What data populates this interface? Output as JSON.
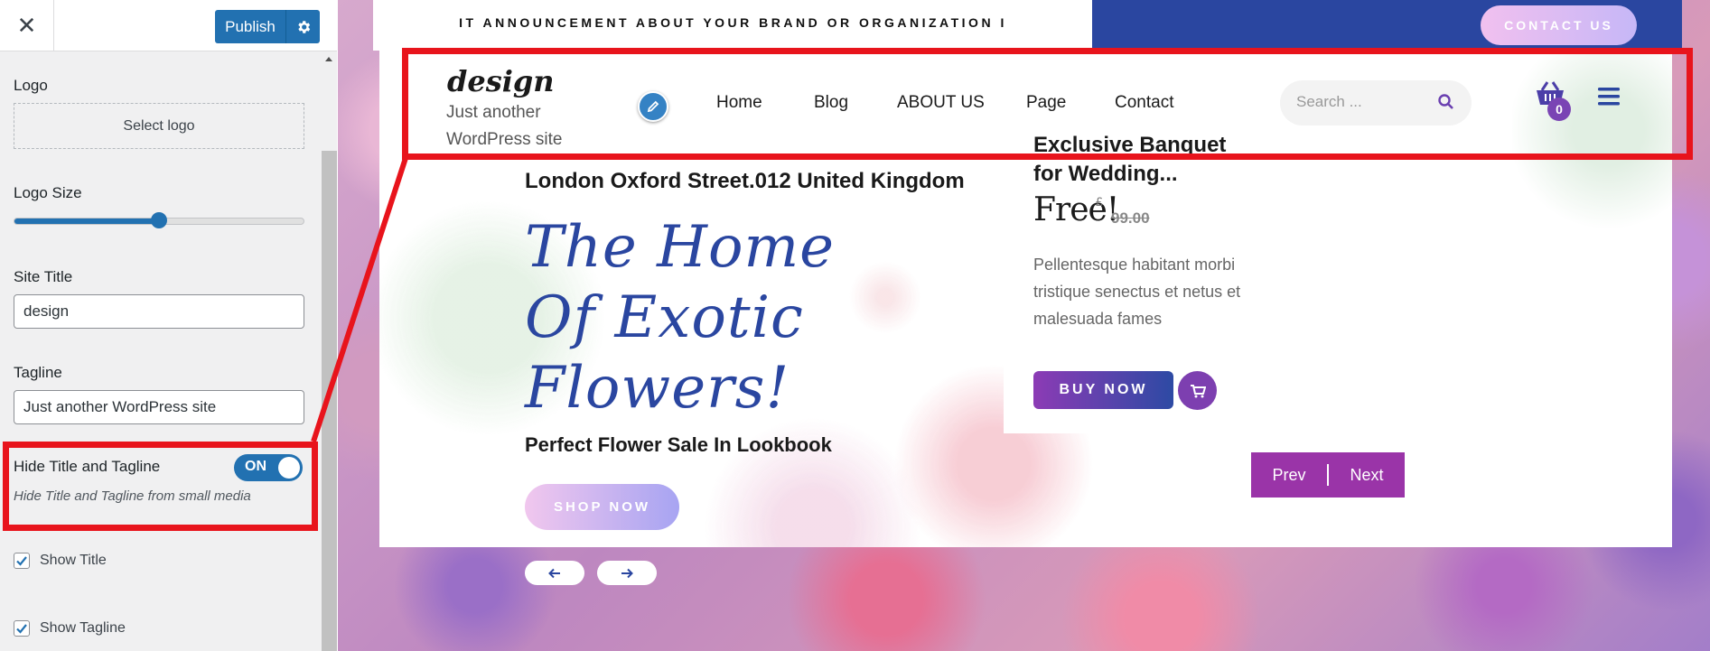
{
  "customizer": {
    "close_icon": "close-icon",
    "publish_label": "Publish",
    "settings_icon": "gear-icon",
    "logo": {
      "label": "Logo",
      "button": "Select logo"
    },
    "logo_size": {
      "label": "Logo Size",
      "value": 0.5
    },
    "site_title": {
      "label": "Site Title",
      "value": "design"
    },
    "tagline": {
      "label": "Tagline",
      "value": "Just another WordPress site"
    },
    "hide_title": {
      "label": "Hide Title and Tagline",
      "toggle": "ON",
      "description": "Hide Title and Tagline from small media"
    },
    "show_title": {
      "label": "Show Title",
      "checked": true
    },
    "show_tagline": {
      "label": "Show Tagline",
      "checked": true
    }
  },
  "preview": {
    "announcement": "IT ANNOUNCEMENT ABOUT YOUR BRAND OR ORGANIZATION I",
    "contact_button": "CONTACT US",
    "site_logo": "design",
    "site_tagline": "Just another WordPress site",
    "nav": [
      "Home",
      "Blog",
      "ABOUT US",
      "Page",
      "Contact"
    ],
    "search_placeholder": "Search ...",
    "cart_count": "0",
    "hero": {
      "address": "London Oxford Street.012 United Kingdom",
      "title": "The Home Of Exotic Flowers!",
      "subtitle": "Perfect Flower Sale In Lookbook",
      "button": "SHOP NOW"
    },
    "product": {
      "title": "Exclusive Banquet for Wedding...",
      "price": "Free!",
      "currency": "£",
      "old_price": "99.00",
      "description": "Pellentesque habitant morbi tristique senectus et netus et malesuada fames",
      "button": "BUY NOW"
    },
    "pager": {
      "prev": "Prev",
      "next": "Next"
    }
  },
  "colors": {
    "wp_blue": "#2271b1",
    "brand_blue": "#2a46a0",
    "purple": "#9a34a8",
    "annotation_red": "#e8141c"
  }
}
